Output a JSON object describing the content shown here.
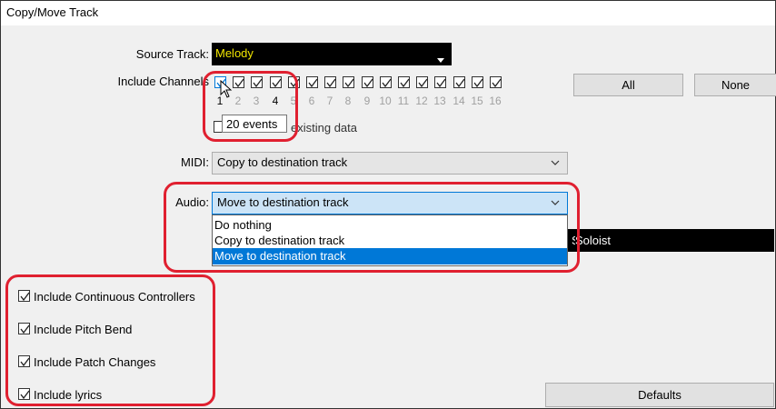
{
  "window": {
    "title": "Copy/Move Track"
  },
  "source_track": {
    "label": "Source Track:",
    "value": "Melody"
  },
  "channels": {
    "label": "Include Channels",
    "numbers": [
      "1",
      "2",
      "3",
      "4",
      "5",
      "6",
      "7",
      "8",
      "9",
      "10",
      "11",
      "12",
      "13",
      "14",
      "15",
      "16"
    ],
    "all_button": "All",
    "none_button": "None"
  },
  "tooltip": {
    "text": "20 events"
  },
  "existing_data_label": "existing data",
  "midi": {
    "label": "MIDI:",
    "value": "Copy to destination track"
  },
  "audio": {
    "label": "Audio:",
    "value": "Move to destination track",
    "options": [
      "Do nothing",
      "Copy to destination track",
      "Move to destination track"
    ],
    "selected_index": 2
  },
  "dest_bar": {
    "text": "Soloist"
  },
  "options": {
    "continuous_controllers": "Include Continuous Controllers",
    "pitch_bend": "Include Pitch Bend",
    "patch_changes": "Include Patch Changes",
    "lyrics": "Include lyrics"
  },
  "defaults_button": "Defaults",
  "colors": {
    "highlight": "#0078d7",
    "annotation": "#e02030",
    "source_value": "#f2e600"
  }
}
